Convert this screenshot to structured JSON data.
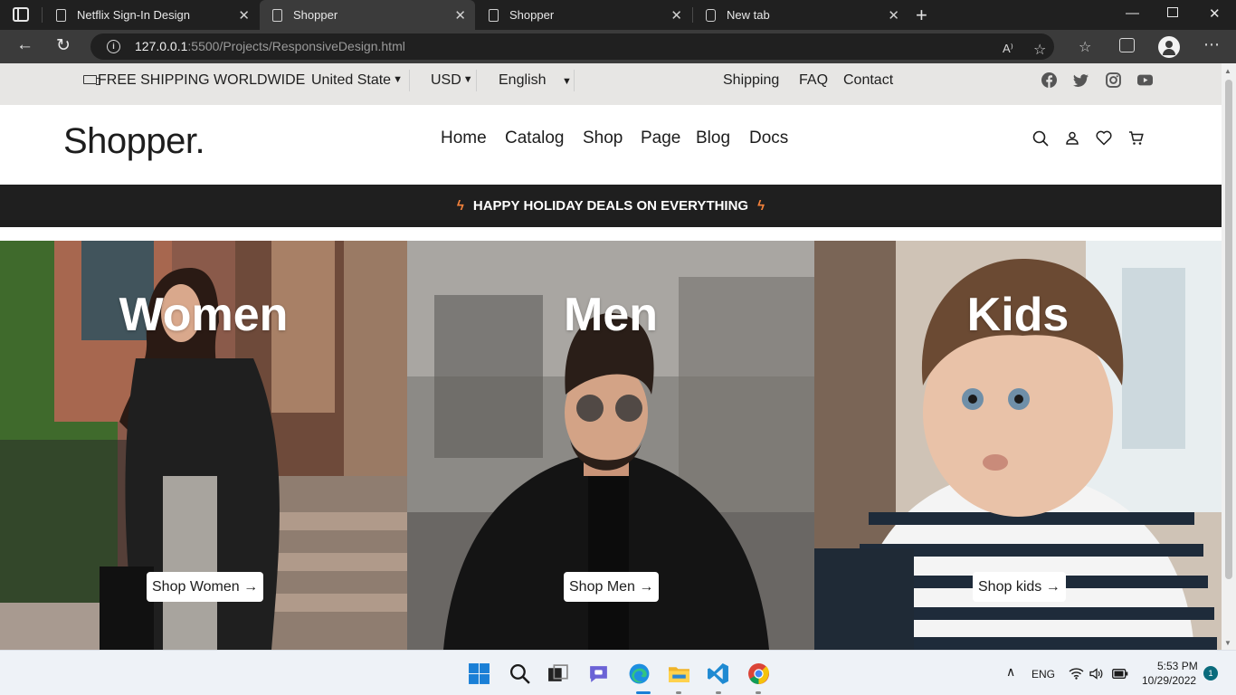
{
  "browser": {
    "tabs": [
      {
        "title": "Netflix Sign-In Design"
      },
      {
        "title": "Shopper"
      },
      {
        "title": "Shopper"
      },
      {
        "title": "New tab"
      }
    ],
    "url_host": "127.0.0.1",
    "url_path": ":5500/Projects/ResponsiveDesign.html"
  },
  "topbar": {
    "shipping_text": "FREE SHIPPING WORLDWIDE",
    "country": "United State",
    "currency": "USD",
    "language": "English",
    "links": [
      "Shipping",
      "FAQ",
      "Contact"
    ]
  },
  "header": {
    "logo": "Shopper.",
    "nav": [
      "Home",
      "Catalog",
      "Shop",
      "Page",
      "Blog",
      "Docs"
    ]
  },
  "promo": {
    "text": "HAPPY HOLIDAY DEALS ON EVERYTHING"
  },
  "categories": [
    {
      "title": "Women",
      "button": "Shop Women"
    },
    {
      "title": "Men",
      "button": "Shop Men"
    },
    {
      "title": "Kids",
      "button": "Shop kids"
    }
  ],
  "taskbar": {
    "language": "ENG",
    "time": "5:53 PM",
    "date": "10/29/2022",
    "notifications": "1"
  },
  "colors": {
    "promo_bolt": "#f5823b",
    "topstrip_bg": "#e7e6e4",
    "promo_bg": "#1f1f1f"
  }
}
